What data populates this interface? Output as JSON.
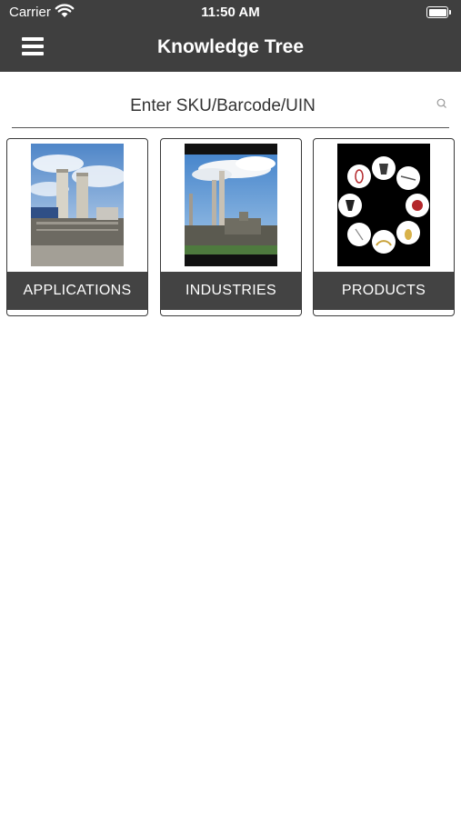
{
  "status_bar": {
    "carrier": "Carrier",
    "time": "11:50 AM",
    "wifi_icon": "wifi-icon",
    "battery_icon": "battery-icon"
  },
  "nav": {
    "title": "Knowledge Tree",
    "menu_icon": "hamburger-menu-icon"
  },
  "search": {
    "placeholder": "Enter SKU/Barcode/UIN",
    "value": "",
    "icon": "search-icon"
  },
  "categories": [
    {
      "label": "APPLICATIONS",
      "image": "industrial-towers-photo"
    },
    {
      "label": "INDUSTRIES",
      "image": "factory-smokestacks-photo"
    },
    {
      "label": "PRODUCTS",
      "image": "safety-equipment-collage"
    }
  ],
  "colors": {
    "nav_bar": "#3f3f3f",
    "card_label_bg": "#434343",
    "background": "#ffffff"
  }
}
